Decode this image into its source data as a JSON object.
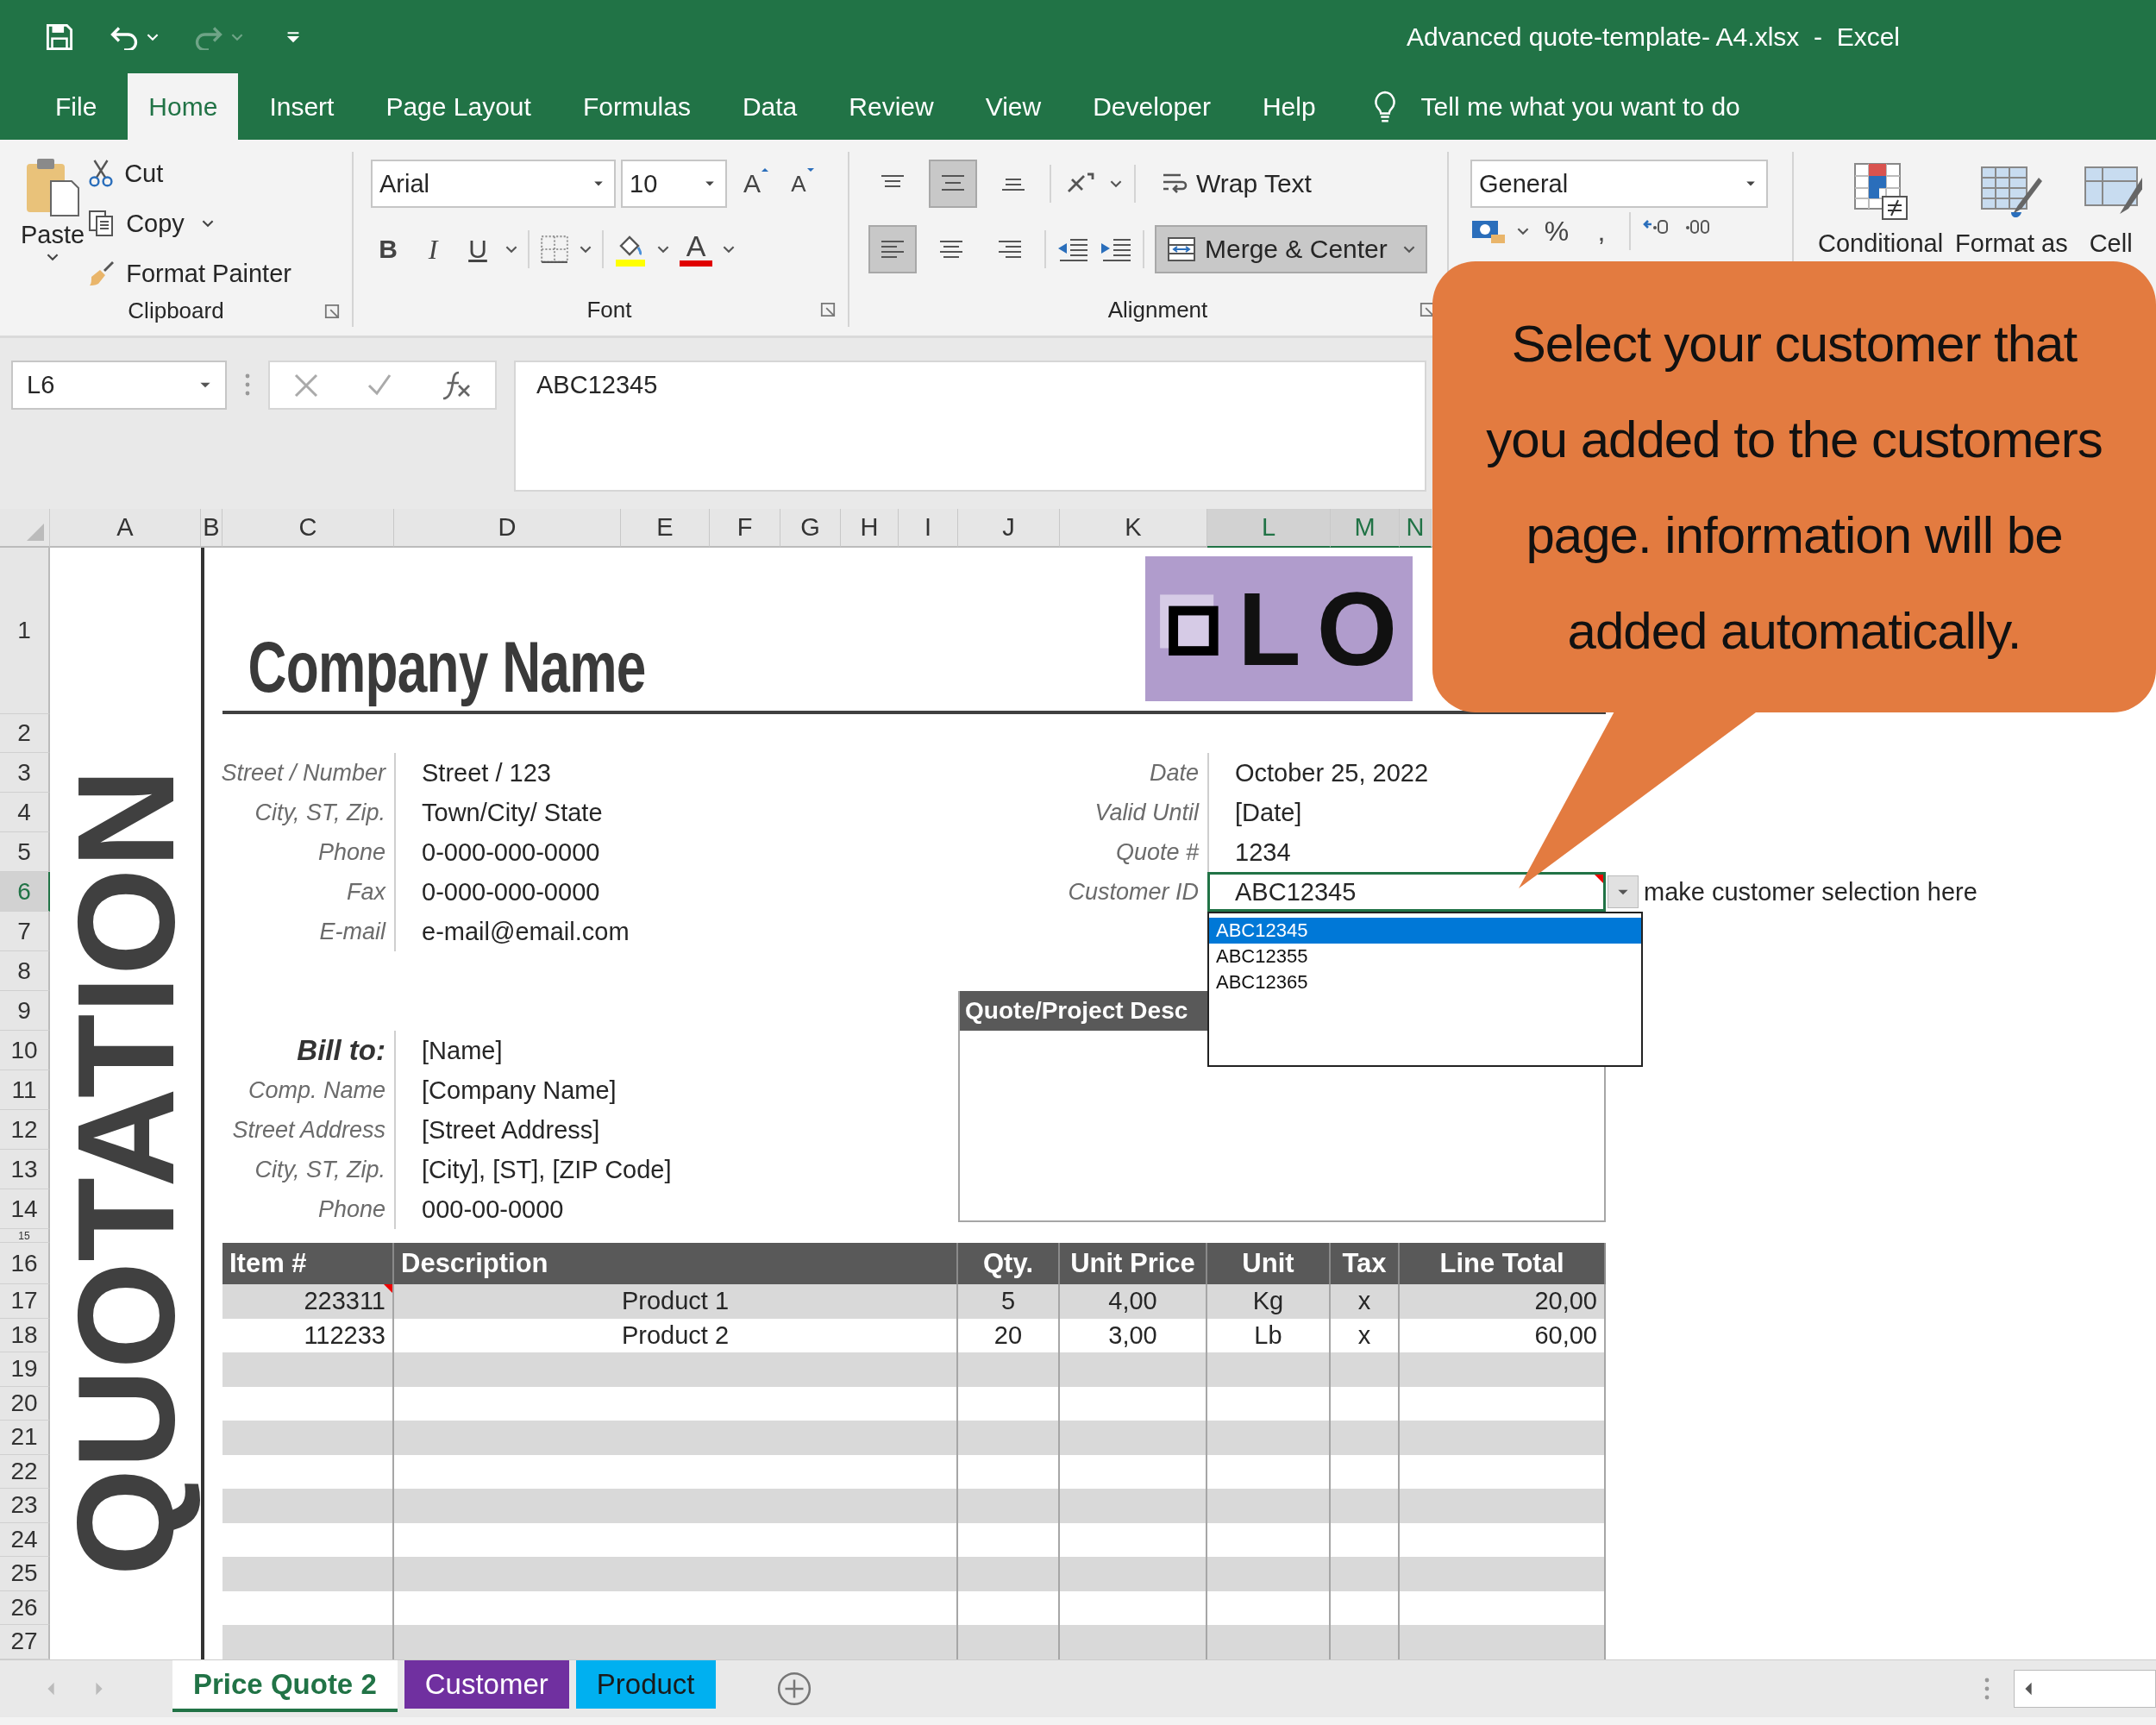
{
  "title_bar": {
    "title": "Advanced quote-template- A4.xlsx  -  Excel",
    "redo_disabled": true
  },
  "ribbon_tabs": [
    {
      "label": "File",
      "selected": false
    },
    {
      "label": "Home",
      "selected": true
    },
    {
      "label": "Insert",
      "selected": false
    },
    {
      "label": "Page Layout",
      "selected": false
    },
    {
      "label": "Formulas",
      "selected": false
    },
    {
      "label": "Data",
      "selected": false
    },
    {
      "label": "Review",
      "selected": false
    },
    {
      "label": "View",
      "selected": false
    },
    {
      "label": "Developer",
      "selected": false
    },
    {
      "label": "Help",
      "selected": false
    }
  ],
  "tell_me": "Tell me what you want to do",
  "clipboard": {
    "paste": "Paste",
    "cut": "Cut",
    "copy": "Copy",
    "format_painter": "Format Painter",
    "label": "Clipboard"
  },
  "font": {
    "name": "Arial",
    "size": "10",
    "grow": "A",
    "shrink": "A",
    "bold": "B",
    "italic": "I",
    "underline": "U",
    "color_letter": "A",
    "label": "Font"
  },
  "alignment": {
    "vertical": [
      {
        "kind": "top",
        "selected": false
      },
      {
        "kind": "middle",
        "selected": true
      },
      {
        "kind": "bottom",
        "selected": false
      }
    ],
    "horizontal": [
      {
        "kind": "left",
        "selected": true
      },
      {
        "kind": "center",
        "selected": false
      },
      {
        "kind": "right",
        "selected": false
      }
    ],
    "wrap_text": {
      "label": "Wrap Text",
      "selected": false
    },
    "merge_center": {
      "label": "Merge & Center",
      "selected": true
    },
    "label": "Alignment"
  },
  "number": {
    "format": "General",
    "percent": "%",
    "comma": ","
  },
  "styles": [
    {
      "label": "Conditional",
      "kind": "conditional"
    },
    {
      "label": "Format as",
      "kind": "table"
    },
    {
      "label": "Cell",
      "kind": "cell"
    }
  ],
  "formula_bar": {
    "name_box": "L6",
    "value": "ABC12345"
  },
  "columns": [
    {
      "label": "A",
      "selected": false
    },
    {
      "label": "B",
      "selected": false
    },
    {
      "label": "C",
      "selected": false
    },
    {
      "label": "D",
      "selected": false
    },
    {
      "label": "E",
      "selected": false
    },
    {
      "label": "F",
      "selected": false
    },
    {
      "label": "G",
      "selected": false
    },
    {
      "label": "H",
      "selected": false
    },
    {
      "label": "I",
      "selected": false
    },
    {
      "label": "J",
      "selected": false
    },
    {
      "label": "K",
      "selected": false
    },
    {
      "label": "L",
      "selected": true
    },
    {
      "label": "M",
      "selected": true
    },
    {
      "label": "N",
      "selected": true
    }
  ],
  "rows": [
    {
      "label": "1",
      "selected": false
    },
    {
      "label": "2",
      "selected": false
    },
    {
      "label": "3",
      "selected": false
    },
    {
      "label": "4",
      "selected": false
    },
    {
      "label": "5",
      "selected": false
    },
    {
      "label": "6",
      "selected": true
    },
    {
      "label": "7",
      "selected": false
    },
    {
      "label": "8",
      "selected": false
    },
    {
      "label": "9",
      "selected": false
    },
    {
      "label": "10",
      "selected": false
    },
    {
      "label": "11",
      "selected": false
    },
    {
      "label": "12",
      "selected": false
    },
    {
      "label": "13",
      "selected": false
    },
    {
      "label": "14",
      "selected": false
    },
    {
      "label": "15",
      "selected": false
    },
    {
      "label": "16",
      "selected": false
    },
    {
      "label": "17",
      "selected": false
    },
    {
      "label": "18",
      "selected": false
    },
    {
      "label": "19",
      "selected": false
    },
    {
      "label": "20",
      "selected": false
    },
    {
      "label": "21",
      "selected": false
    },
    {
      "label": "22",
      "selected": false
    },
    {
      "label": "23",
      "selected": false
    },
    {
      "label": "24",
      "selected": false
    },
    {
      "label": "25",
      "selected": false
    },
    {
      "label": "26",
      "selected": false
    },
    {
      "label": "27",
      "selected": false
    }
  ],
  "sheet": {
    "banner": "QUOTATION",
    "company_name": "Company Name",
    "logo_text": "LO",
    "address": [
      {
        "label": "Street / Number",
        "value": "Street / 123"
      },
      {
        "label": "City, ST, Zip.",
        "value": "Town/City/ State"
      },
      {
        "label": "Phone",
        "value": "0-000-000-0000"
      },
      {
        "label": "Fax",
        "value": "0-000-000-0000"
      },
      {
        "label": "E-mail",
        "value": "e-mail@email.com"
      }
    ],
    "quote_info": [
      {
        "label": "Date",
        "value": "October 25, 2022",
        "kind": "text"
      },
      {
        "label": "Valid Until",
        "value": "[Date]",
        "kind": "text"
      },
      {
        "label": "Quote #",
        "value": "1234",
        "kind": "text"
      },
      {
        "label": "Customer ID",
        "value": "ABC12345",
        "kind": "dropdown",
        "note": true
      }
    ],
    "hint": "make customer selection here",
    "dropdown_options": [
      {
        "label": "ABC12345",
        "selected": true
      },
      {
        "label": "ABC12355",
        "selected": false
      },
      {
        "label": "ABC12365",
        "selected": false
      }
    ],
    "bill_to": [
      {
        "label": "Bill to:",
        "value": "[Name]",
        "kind": "heading"
      },
      {
        "label": "Comp. Name",
        "value": "[Company Name]",
        "kind": "field"
      },
      {
        "label": "Street Address",
        "value": "[Street Address]",
        "kind": "field"
      },
      {
        "label": "City, ST, Zip.",
        "value": "[City], [ST], [ZIP Code]",
        "kind": "field"
      },
      {
        "label": "Phone",
        "value": "000-00-0000",
        "kind": "field"
      }
    ],
    "description_title": "Quote/Project Desc",
    "items_table": {
      "columns": [
        "Item #",
        "Description",
        "Qty.",
        "Unit Price",
        "Unit",
        "Tax",
        "Line Total"
      ],
      "rows": [
        {
          "cells": [
            "223311",
            "Product 1",
            "5",
            "4,00",
            "Kg",
            "x",
            "20,00"
          ],
          "note": true
        },
        {
          "cells": [
            "112233",
            "Product 2",
            "20",
            "3,00",
            "Lb",
            "x",
            "60,00"
          ],
          "note": false
        }
      ]
    }
  },
  "sheet_tabs": [
    {
      "label": "Price Quote 2",
      "selected": true,
      "color": "#217346"
    },
    {
      "label": "Customer",
      "selected": false,
      "color": "#7030a0"
    },
    {
      "label": "Product",
      "selected": false,
      "color": "#00b0f0"
    }
  ],
  "callout": {
    "text": "Select your customer that you added to the customers page. information will be added automatically."
  }
}
